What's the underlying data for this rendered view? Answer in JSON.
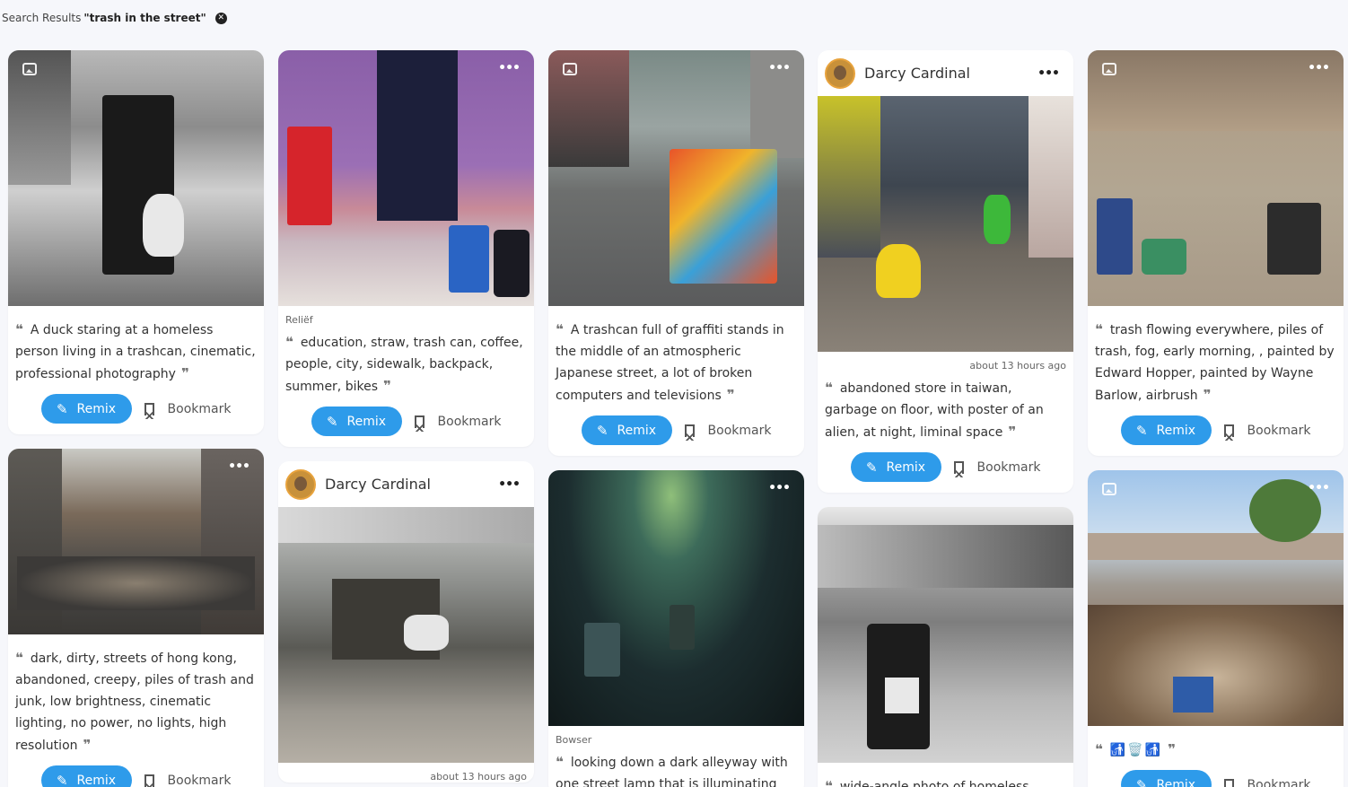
{
  "search": {
    "label": "Search Results",
    "query": "\"trash in the street\"",
    "clear_icon": "close-circle-icon"
  },
  "actions": {
    "remix": "Remix",
    "bookmark": "Bookmark"
  },
  "cards": {
    "c1": {
      "prompt": "A duck staring at a homeless person living in a trashcan, cinematic, professional photography"
    },
    "c2": {
      "meta": "Reliëf",
      "prompt": "education, straw, trash can, coffee, people, city, sidewalk, backpack, summer, bikes"
    },
    "c3": {
      "prompt": "A trashcan full of graffiti stands in the middle of an atmospheric Japanese street, a lot of broken computers and televisions"
    },
    "c4": {
      "user": "Darcy Cardinal",
      "meta": "about 13 hours ago",
      "prompt": "abandoned store in taiwan, garbage on floor, with poster of an alien, at night, liminal space"
    },
    "c5": {
      "prompt": "trash flowing everywhere, piles of trash, fog, early morning, , painted by Edward Hopper, painted by Wayne Barlow, airbrush"
    },
    "c6": {
      "prompt": "dark, dirty, streets of hong kong, abandoned, creepy, piles of trash and junk, low brightness, cinematic lighting, no power, no lights, high resolution"
    },
    "c7": {
      "user": "Darcy Cardinal",
      "meta": "about 13 hours ago"
    },
    "c8": {
      "meta": "Bowser",
      "prompt": "looking down a dark alleyway with one street lamp that is illuminating"
    },
    "c9": {
      "prompt": "wide-angle photo of homeless"
    },
    "c10": {
      "prompt": "🚮🗑️🚮"
    }
  },
  "colors": {
    "accent": "#2e9bea",
    "background": "#f6f7fb"
  }
}
